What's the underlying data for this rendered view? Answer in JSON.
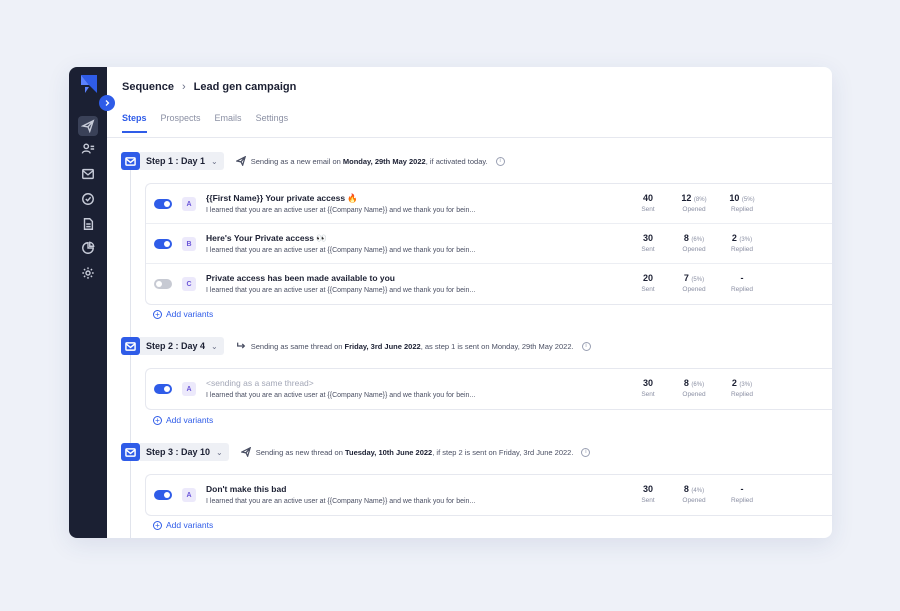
{
  "colors": {
    "accent": "#2f5ce8",
    "rail": "#1b2033",
    "page_bg": "#eef1f8"
  },
  "rail": {
    "icons": [
      "send-icon",
      "prospects-icon",
      "inbox-icon",
      "tasks-icon",
      "document-icon",
      "chart-icon",
      "gear-icon"
    ],
    "active": "send-icon"
  },
  "breadcrumb": {
    "root": "Sequence",
    "separator": "›",
    "current": "Lead gen campaign"
  },
  "tabs": [
    {
      "label": "Steps",
      "active": true
    },
    {
      "label": "Prospects",
      "active": false
    },
    {
      "label": "Emails",
      "active": false
    },
    {
      "label": "Settings",
      "active": false
    }
  ],
  "steps": [
    {
      "label": "Step 1 : Day 1",
      "note_pre": "Sending as a new email on ",
      "note_bold": "Monday, 29th May 2022",
      "note_post": ", if activated today.",
      "variants": [
        {
          "enabled": true,
          "letter": "A",
          "subject": "{{First Name}} Your private access 🔥",
          "preview": "I learned that you are an active user at {{Company Name}} and we thank you for bein...",
          "sent": "40",
          "opened": "12",
          "opened_pct": "(8%)",
          "replied": "10",
          "replied_pct": "(5%)"
        },
        {
          "enabled": true,
          "letter": "B",
          "subject": "Here's Your Private access 👀",
          "preview": "I learned that you are an active user at {{Company Name}} and we thank you for bein...",
          "sent": "30",
          "opened": "8",
          "opened_pct": "(6%)",
          "replied": "2",
          "replied_pct": "(3%)"
        },
        {
          "enabled": false,
          "letter": "C",
          "subject": "Private access has been made available to you",
          "preview": "I learned that you are an active user at {{Company Name}} and we thank you for bein...",
          "sent": "20",
          "opened": "7",
          "opened_pct": "(5%)",
          "replied": "-",
          "replied_pct": ""
        }
      ]
    },
    {
      "label": "Step 2 : Day 4",
      "note_pre": "Sending as same thread on ",
      "note_bold": "Friday, 3rd June 2022",
      "note_post": ", as step 1 is sent on Monday, 29th May 2022.",
      "variants": [
        {
          "enabled": true,
          "letter": "A",
          "subject": "<sending as a same thread>",
          "muted": true,
          "preview": "I learned that you are an active user at {{Company Name}} and we thank you for bein...",
          "sent": "30",
          "opened": "8",
          "opened_pct": "(6%)",
          "replied": "2",
          "replied_pct": "(3%)"
        }
      ]
    },
    {
      "label": "Step 3 : Day 10",
      "note_pre": "Sending as new thread on ",
      "note_bold": "Tuesday, 10th June 2022",
      "note_post": ", if step 2 is sent on Friday, 3rd June 2022.",
      "variants": [
        {
          "enabled": true,
          "letter": "A",
          "subject": "Don't make this bad",
          "preview": "I learned that you are an active user at {{Company Name}} and we thank you for bein...",
          "sent": "30",
          "opened": "8",
          "opened_pct": "(4%)",
          "replied": "-",
          "replied_pct": ""
        }
      ]
    }
  ],
  "labels": {
    "sent": "Sent",
    "opened": "Opened",
    "replied": "Replied",
    "add_variants": "Add variants",
    "info": "i"
  }
}
